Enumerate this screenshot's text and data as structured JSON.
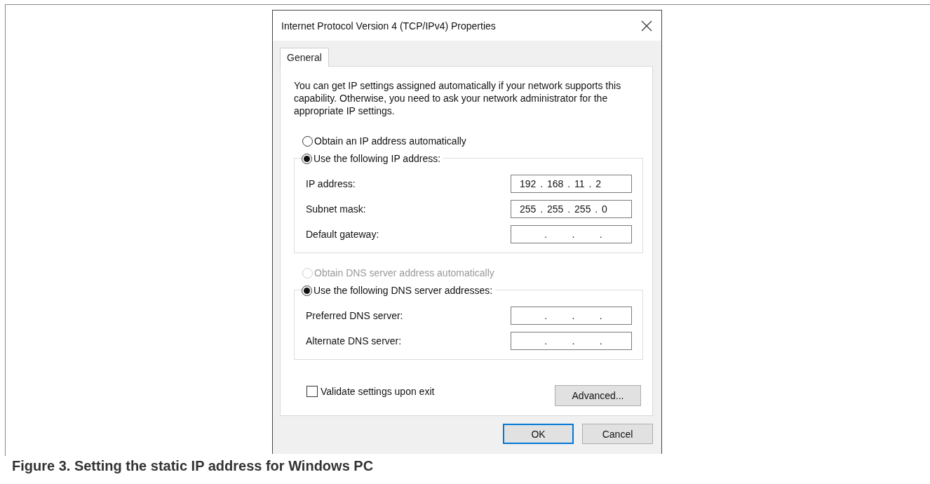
{
  "dialog": {
    "title": "Internet Protocol Version 4 (TCP/IPv4) Properties",
    "tabs": [
      {
        "label": "General",
        "selected": true
      }
    ],
    "description": "You can get IP settings assigned automatically if your network supports this capability. Otherwise, you need to ask your network administrator for the appropriate IP settings.",
    "sections": [
      {
        "options": [
          {
            "label": "Obtain an IP address automatically",
            "selected": false,
            "disabled": false
          },
          {
            "label": "Use the following IP address:",
            "selected": true,
            "disabled": false
          }
        ],
        "fields": [
          {
            "label": "IP address:",
            "value": "192 . 168 . 11 . 2"
          },
          {
            "label": "Subnet mask:",
            "value": "255 . 255 . 255 . 0"
          },
          {
            "label": "Default gateway:",
            "value": "      .      .      ."
          }
        ]
      },
      {
        "options": [
          {
            "label": "Obtain DNS server address automatically",
            "selected": false,
            "disabled": true
          },
          {
            "label": "Use the following DNS server addresses:",
            "selected": true,
            "disabled": false
          }
        ],
        "fields": [
          {
            "label": "Preferred DNS server:",
            "value": "      .      .      ."
          },
          {
            "label": "Alternate DNS server:",
            "value": "      .      .      ."
          }
        ]
      }
    ],
    "validate": {
      "label": "Validate settings upon exit",
      "checked": false
    },
    "advanced_button": "Advanced...",
    "buttons": [
      {
        "label": "OK",
        "default": true
      },
      {
        "label": "Cancel",
        "default": false
      }
    ]
  },
  "caption": "Figure 3.  Setting the static IP address for Windows PC"
}
